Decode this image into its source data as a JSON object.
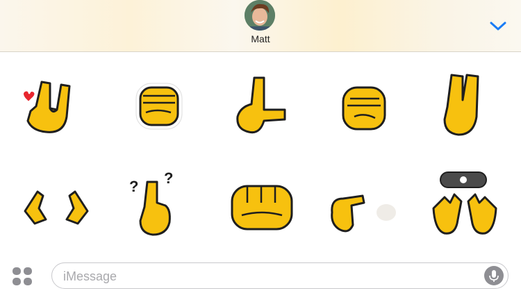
{
  "header": {
    "contact_name": "Matt"
  },
  "sticker_grid": {
    "stickers": [
      {
        "name": "rock-on-heart-hand"
      },
      {
        "name": "fist"
      },
      {
        "name": "loser-l-hand"
      },
      {
        "name": "fist"
      },
      {
        "name": "two-fingers-up"
      },
      {
        "name": "double-finger-point"
      },
      {
        "name": "confused-finger-point"
      },
      {
        "name": "punch-fist"
      },
      {
        "name": "finger-gun"
      },
      {
        "name": "jazz-hands-with-camera"
      }
    ]
  },
  "composer": {
    "placeholder": "iMessage",
    "value": ""
  },
  "colors": {
    "accent": "#1a7cf5",
    "hand_yellow": "#f7c10f",
    "hand_outline": "#1f1f1f",
    "heart": "#e8262e"
  }
}
